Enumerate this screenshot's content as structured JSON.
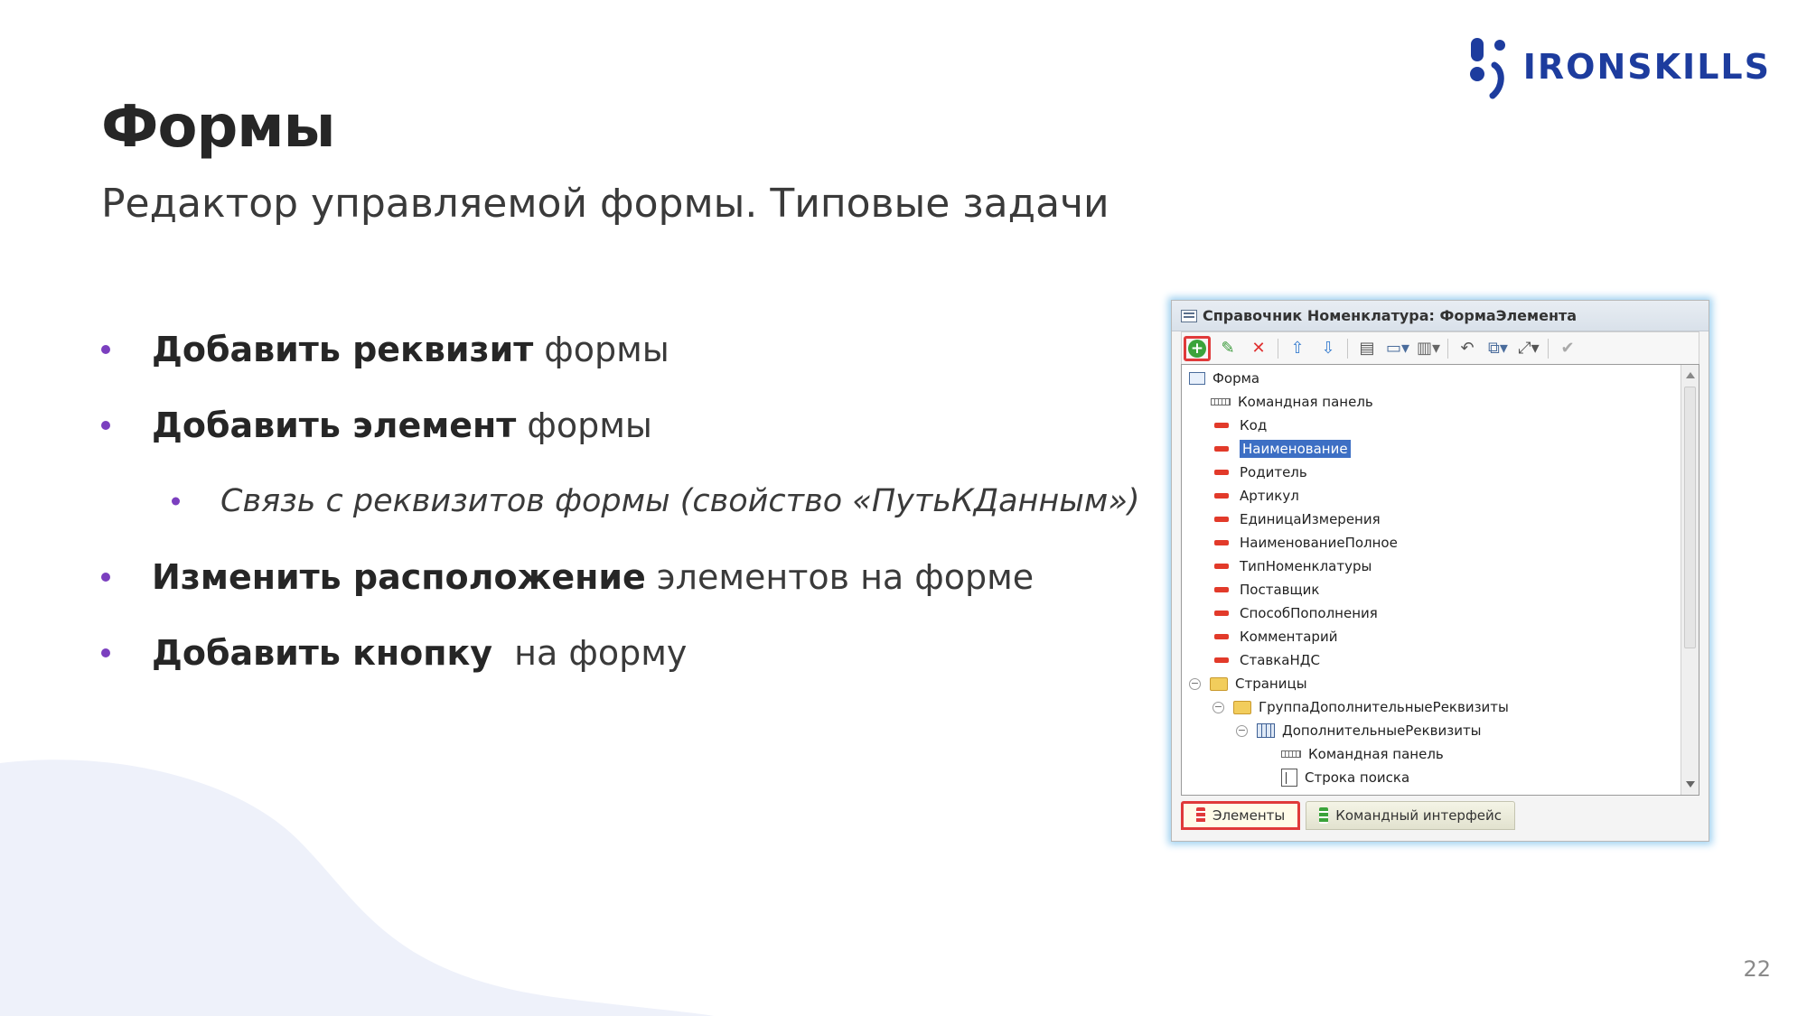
{
  "brand": {
    "logo_text": "IRONSKILLS"
  },
  "slide": {
    "title": "Формы",
    "subtitle": "Редактор управляемой формы. Типовые задачи",
    "page_number": "22"
  },
  "bullets": [
    {
      "bold": "Добавить реквизит",
      "text": "формы"
    },
    {
      "bold": "Добавить элемент",
      "text": "формы"
    },
    {
      "bold": "",
      "text": "Связь с реквизитов формы (свойство «ПутьКДанным»)"
    },
    {
      "bold": "Изменить расположение",
      "text": "элементов на форме"
    },
    {
      "bold": "Добавить кнопку",
      "text": " на форму"
    }
  ],
  "window": {
    "title": "Справочник Номенклатура: ФормаЭлемента",
    "toolbar_icons": [
      "add-icon",
      "edit-icon",
      "delete-icon",
      "move-up-icon",
      "move-down-icon",
      "properties-icon",
      "display-icon",
      "group-icon",
      "undo-icon",
      "resize-icon",
      "expand-icon",
      "check-icon"
    ],
    "tree": [
      {
        "label": "Форма",
        "icon": "form-icon"
      },
      {
        "label": "Командная панель",
        "icon": "command-panel-icon"
      },
      {
        "label": "Код",
        "icon": "field-icon"
      },
      {
        "label": "Наименование",
        "icon": "field-icon",
        "selected": true
      },
      {
        "label": "Родитель",
        "icon": "field-icon"
      },
      {
        "label": "Артикул",
        "icon": "field-icon"
      },
      {
        "label": "ЕдиницаИзмерения",
        "icon": "field-icon"
      },
      {
        "label": "НаименованиеПолное",
        "icon": "field-icon"
      },
      {
        "label": "ТипНоменклатуры",
        "icon": "field-icon"
      },
      {
        "label": "Поставщик",
        "icon": "field-icon"
      },
      {
        "label": "СпособПополнения",
        "icon": "field-icon"
      },
      {
        "label": "Комментарий",
        "icon": "field-icon"
      },
      {
        "label": "СтавкаНДС",
        "icon": "field-icon"
      },
      {
        "label": "Страницы",
        "icon": "folder-icon",
        "expanded": true
      },
      {
        "label": "ГруппаДополнительныеРеквизиты",
        "icon": "folder-icon",
        "expanded": true
      },
      {
        "label": "ДополнительныеРеквизиты",
        "icon": "table-icon",
        "expanded": true
      },
      {
        "label": "Командная панель",
        "icon": "command-panel-icon"
      },
      {
        "label": "Строка поиска",
        "icon": "search-string-icon"
      }
    ],
    "tabs": [
      {
        "label": "Элементы",
        "active": true
      },
      {
        "label": "Командный интерфейс",
        "active": false
      }
    ]
  },
  "colors": {
    "accent_bullet": "#7b3fbf",
    "brand_blue": "#1d3c9e",
    "highlight_red": "#e03a3a",
    "selection_blue": "#3d6fc4"
  }
}
